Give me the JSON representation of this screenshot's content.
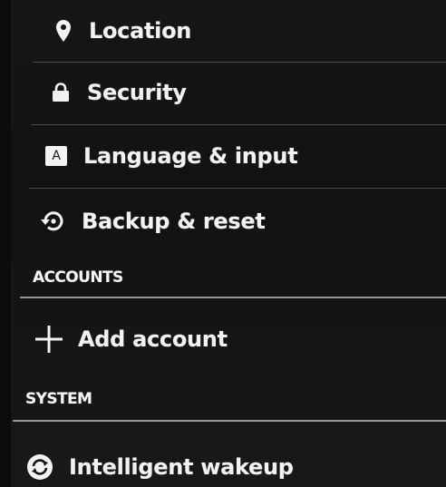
{
  "settings": {
    "items": [
      {
        "label": "Location",
        "icon": "location-pin-icon"
      },
      {
        "label": "Security",
        "icon": "lock-icon"
      },
      {
        "label": "Language & input",
        "icon": "language-icon",
        "icon_text": "A"
      },
      {
        "label": "Backup & reset",
        "icon": "backup-restore-icon"
      }
    ],
    "accounts": {
      "header": "ACCOUNTS",
      "add_account": {
        "label": "Add account",
        "icon": "plus-icon"
      }
    },
    "system": {
      "header": "SYSTEM",
      "intelligent_wakeup": {
        "label": "Intelligent wakeup",
        "icon": "wakeup-icon"
      }
    }
  },
  "colors": {
    "background": "#141414",
    "text": "#f2f2f2",
    "divider": "#4a4a4a",
    "section_divider": "#9a9a9a"
  }
}
